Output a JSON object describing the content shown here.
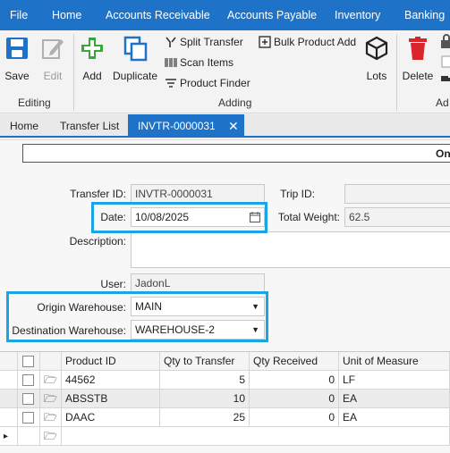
{
  "menu": {
    "items": [
      "File",
      "Home",
      "Accounts Receivable",
      "Accounts Payable",
      "Inventory",
      "Banking"
    ]
  },
  "ribbon": {
    "save": "Save",
    "edit": "Edit",
    "add": "Add",
    "duplicate": "Duplicate",
    "split_transfer": "Split Transfer",
    "scan_items": "Scan Items",
    "product_finder": "Product Finder",
    "bulk_product_add": "Bulk Product Add",
    "lots": "Lots",
    "delete": "Delete",
    "ad_partial": "Ad",
    "groups": {
      "editing": "Editing",
      "adding": "Adding"
    }
  },
  "tabs": [
    {
      "label": "Home"
    },
    {
      "label": "Transfer List"
    },
    {
      "label": "INVTR-0000031"
    }
  ],
  "toolbar": {
    "on_partial": "On"
  },
  "form": {
    "transfer_id_label": "Transfer ID:",
    "transfer_id": "INVTR-0000031",
    "trip_id_label": "Trip ID:",
    "trip_id": "",
    "date_label": "Date:",
    "date": "10/08/2025",
    "total_weight_label": "Total Weight:",
    "total_weight": "62.5",
    "description_label": "Description:",
    "description": "",
    "user_label": "User:",
    "user": "JadonL",
    "origin_label": "Origin Warehouse:",
    "origin": "MAIN",
    "destination_label": "Destination Warehouse:",
    "destination": "WAREHOUSE-2"
  },
  "grid": {
    "columns": [
      "Product ID",
      "Qty to Transfer",
      "Qty Received",
      "Unit of Measure"
    ],
    "rows": [
      {
        "product_id": "44562",
        "qty_to_transfer": "5",
        "qty_received": "0",
        "uom": "LF"
      },
      {
        "product_id": "ABSSTB",
        "qty_to_transfer": "10",
        "qty_received": "0",
        "uom": "EA"
      },
      {
        "product_id": "DAAC",
        "qty_to_transfer": "25",
        "qty_received": "0",
        "uom": "EA"
      }
    ],
    "new_row_marker": "▸"
  },
  "colors": {
    "accent": "#1e73c9",
    "highlight": "#1aa4e6"
  }
}
